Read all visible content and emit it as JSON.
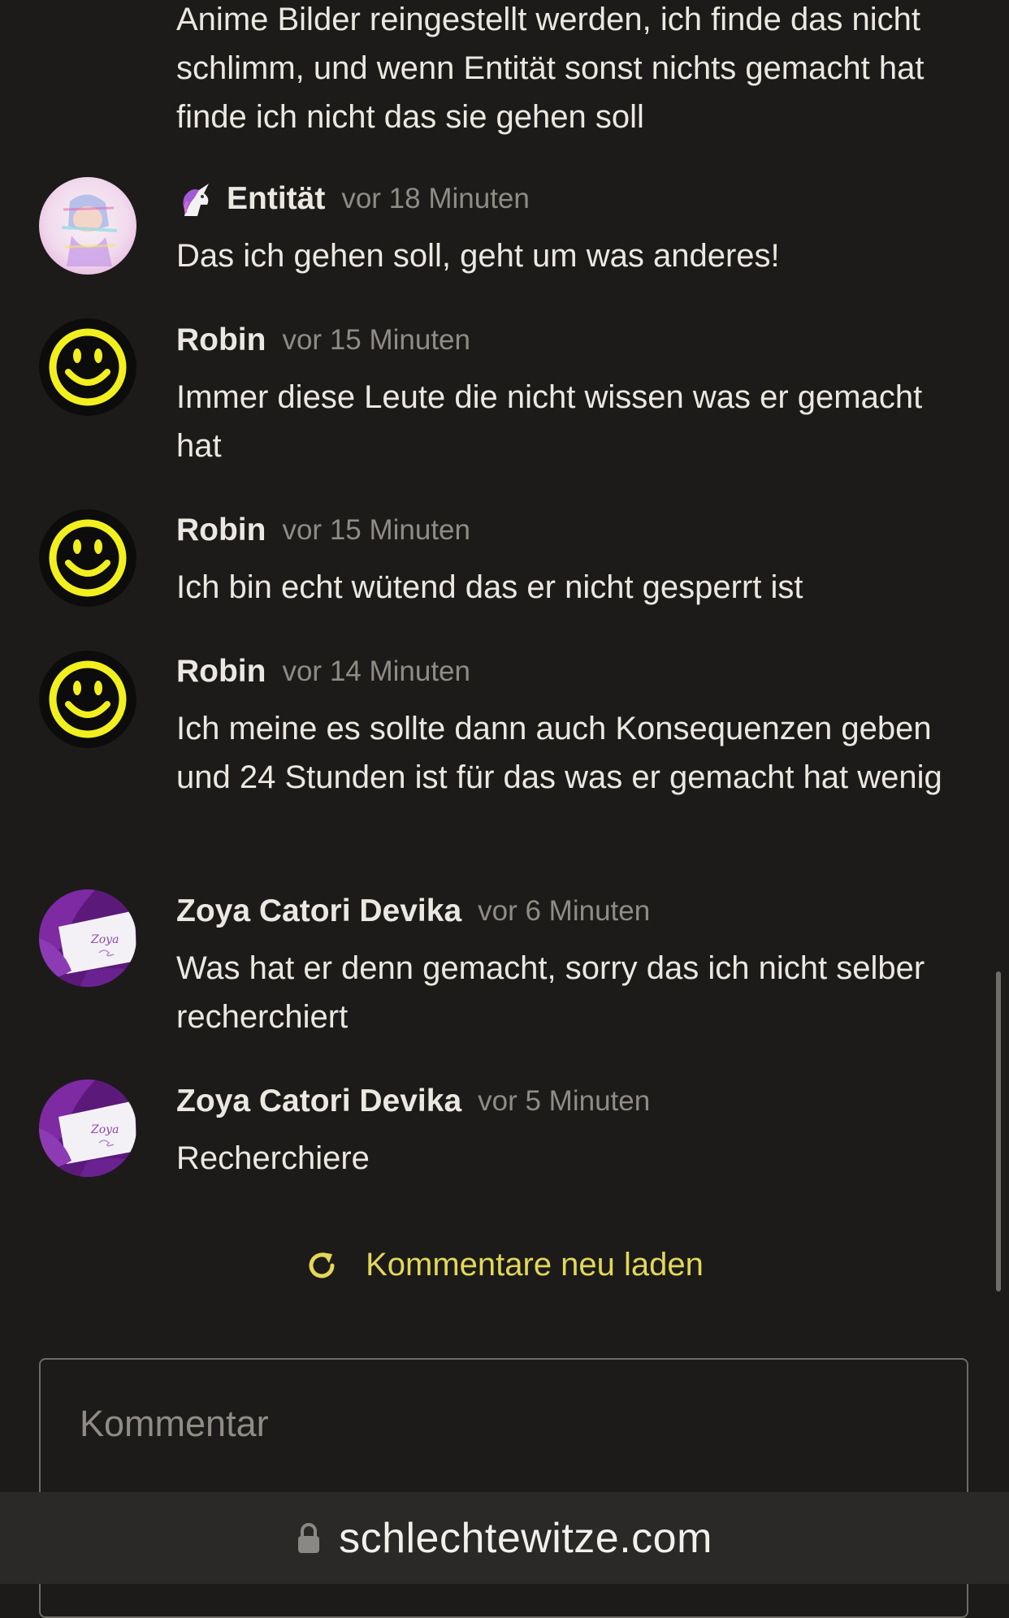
{
  "intro_text": "Anime Bilder reingestellt werden, ich finde das nicht schlimm, und wenn Entität sonst nichts gemacht hat finde ich nicht das sie gehen soll",
  "comments": [
    {
      "name": "Entität",
      "time": "vor 18 Minuten",
      "text": "Das ich gehen soll, geht um was anderes!",
      "icon": "unicorn-icon"
    },
    {
      "name": "Robin",
      "time": "vor 15 Minuten",
      "text": "Immer diese Leute die nicht wissen was er gemacht hat"
    },
    {
      "name": "Robin",
      "time": "vor 15 Minuten",
      "text": "Ich bin echt wütend das er nicht gesperrt ist"
    },
    {
      "name": "Robin",
      "time": "vor 14 Minuten",
      "text": "Ich meine es sollte dann auch Konsequenzen geben und 24 Stunden ist für das was er gemacht hat wenig"
    },
    {
      "name": "Zoya Catori Devika",
      "time": "vor 6 Minuten",
      "text": "Was hat er denn gemacht, sorry das ich nicht selber recherchiert",
      "avatar_text": "Zoya"
    },
    {
      "name": "Zoya Catori Devika",
      "time": "vor 5 Minuten",
      "text": "Recherchiere",
      "avatar_text": "Zoya"
    }
  ],
  "reload_label": "Kommentare neu laden",
  "comment_input": {
    "placeholder": "Kommentar",
    "value": ""
  },
  "url": "schlechtewitze.com",
  "colors": {
    "background": "#1c1b19",
    "accent": "#e3d75a",
    "text": "#ebe8e1",
    "muted": "#8f8c86"
  }
}
